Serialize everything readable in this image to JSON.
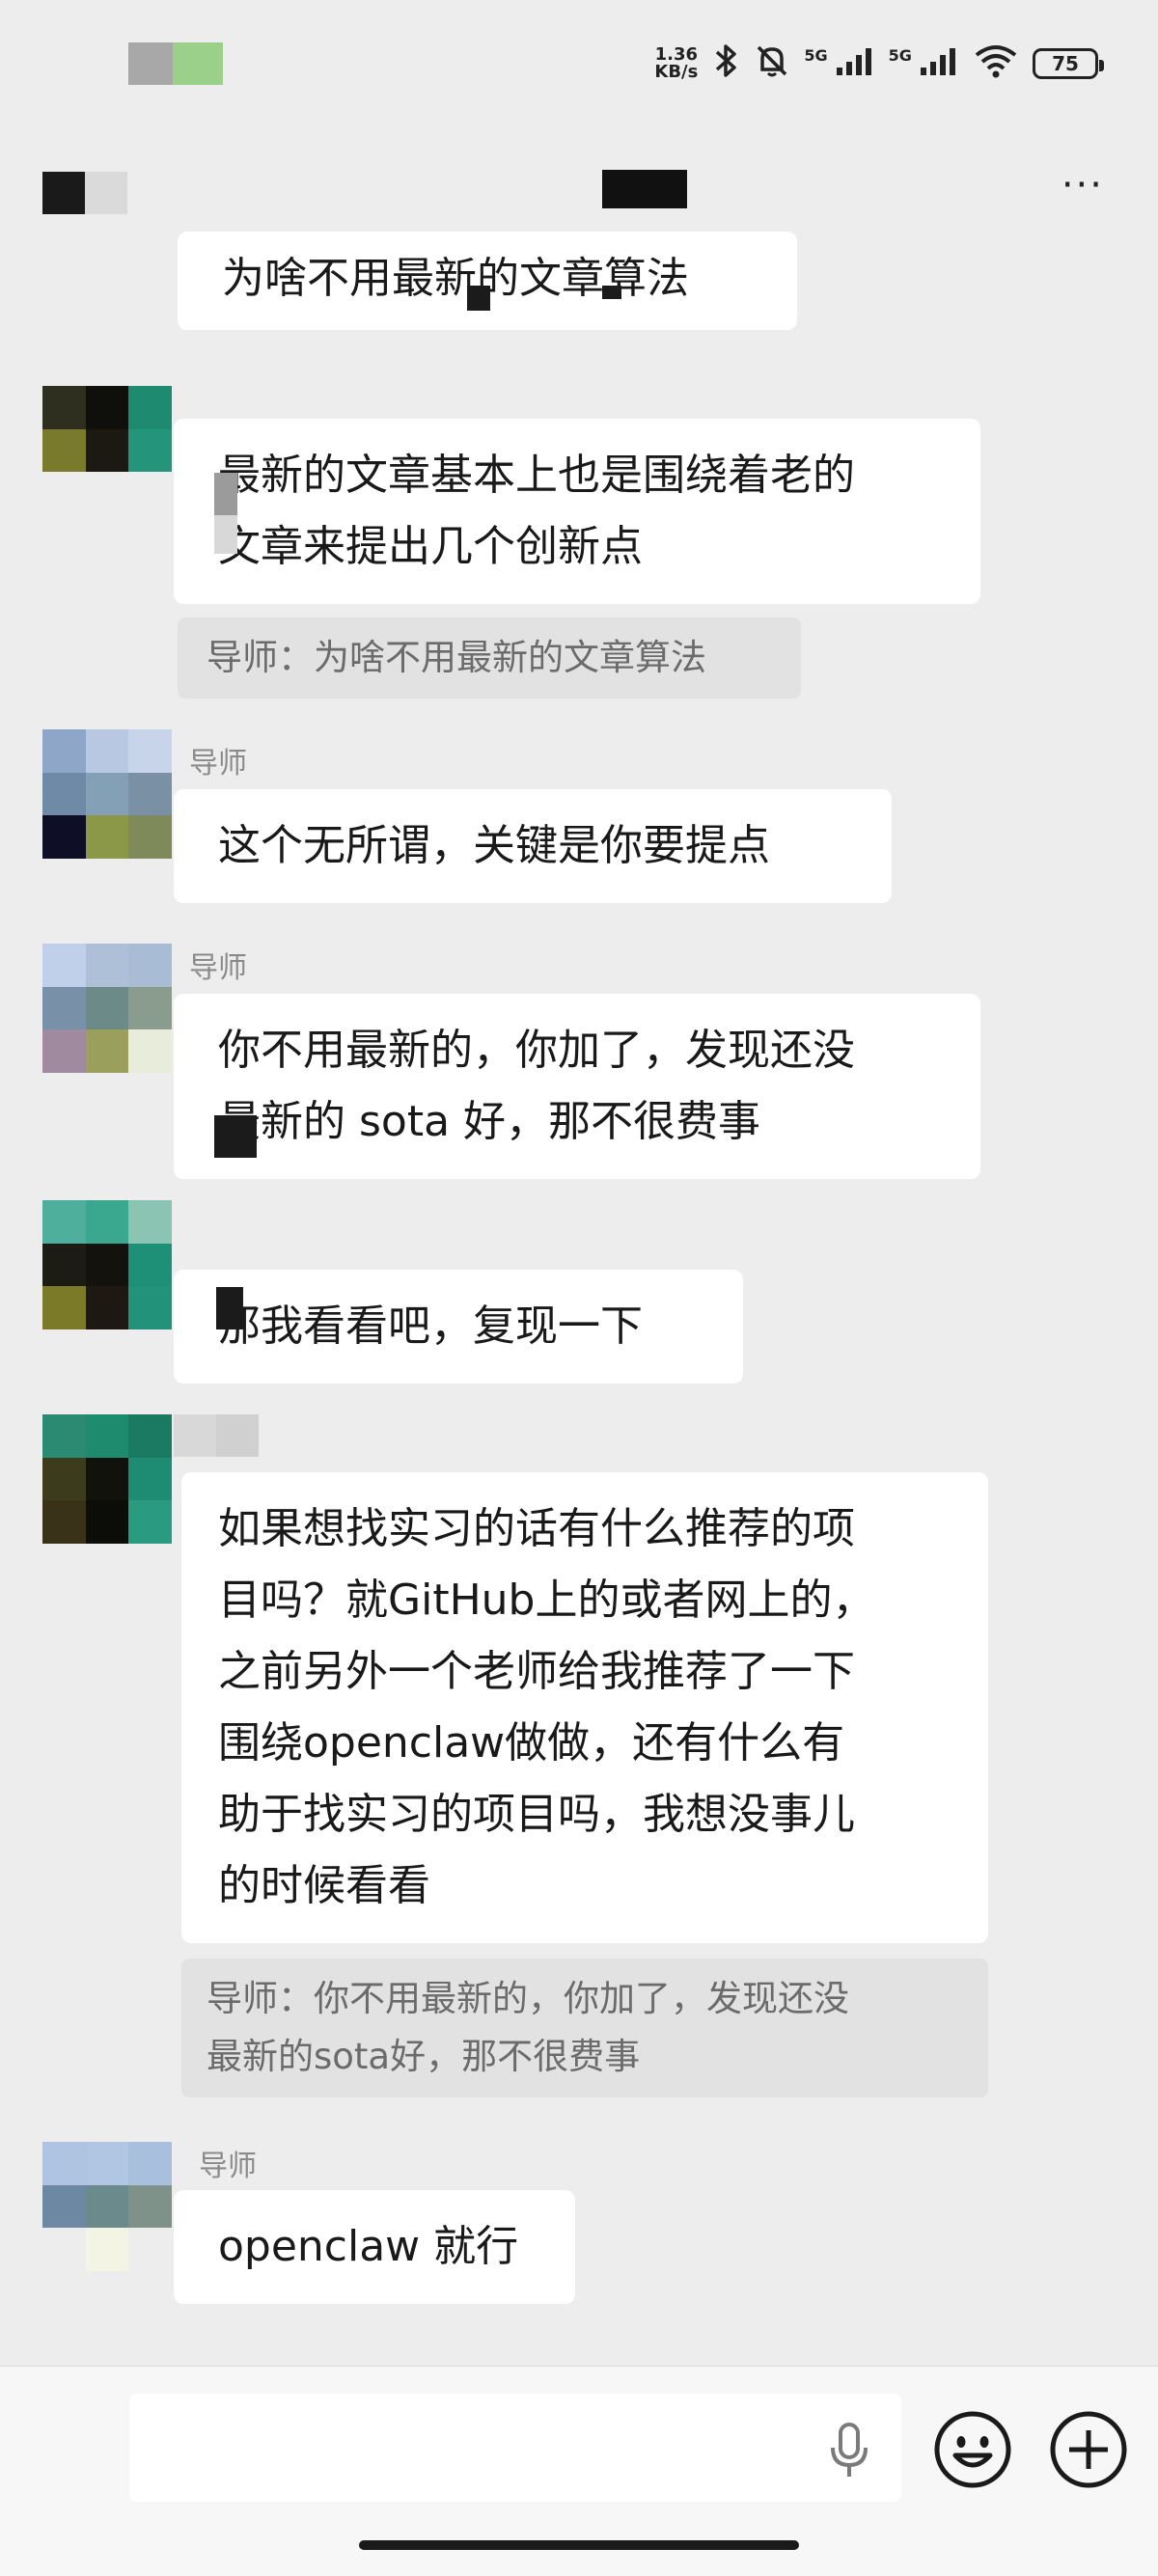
{
  "status_bar": {
    "net_speed_top": "1.36",
    "net_speed_unit": "KB/s",
    "bluetooth_icon": "✱",
    "mute_icon": "🔕",
    "signal_1": "5G",
    "signal_2": "5G",
    "wifi_icon": "wifi-icon",
    "battery": "75"
  },
  "header": {
    "more_label": "···"
  },
  "messages": [
    {
      "type": "text",
      "text_lines": [
        "为啥不用最新的文章算法"
      ]
    },
    {
      "type": "text",
      "text_lines": [
        "最新的文章基本上也是围绕着老的",
        "文章来提出几个创新点"
      ]
    },
    {
      "type": "quote",
      "text_lines": [
        "导师：为啥不用最新的文章算法"
      ]
    },
    {
      "sender": "导师",
      "type": "text",
      "text_lines": [
        "这个无所谓，关键是你要提点"
      ]
    },
    {
      "sender": "导师",
      "type": "text",
      "text_lines": [
        "你不用最新的，你加了，发现还没",
        "最新的 sota 好，那不很费事"
      ]
    },
    {
      "type": "text",
      "text_lines": [
        "那我看看吧，复现一下"
      ]
    },
    {
      "type": "text",
      "text_lines": [
        "如果想找实习的话有什么推荐的项",
        "目吗？就GitHub上的或者网上的，",
        "之前另外一个老师给我推荐了一下",
        "围绕openclaw做做，还有什么有",
        "助于找实习的项目吗，我想没事儿",
        "的时候看看"
      ]
    },
    {
      "type": "quote",
      "text_lines": [
        "导师：你不用最新的，你加了，发现还没",
        "最新的sota好，那不很费事"
      ]
    },
    {
      "sender": "导师",
      "type": "text",
      "text_lines": [
        "openclaw 就行"
      ]
    }
  ],
  "input": {
    "value": "",
    "placeholder": ""
  },
  "colors": {
    "background": "#ededed",
    "bubble": "#ffffff",
    "quote": "#e2e2e2",
    "input_bar": "#f7f7f7"
  }
}
